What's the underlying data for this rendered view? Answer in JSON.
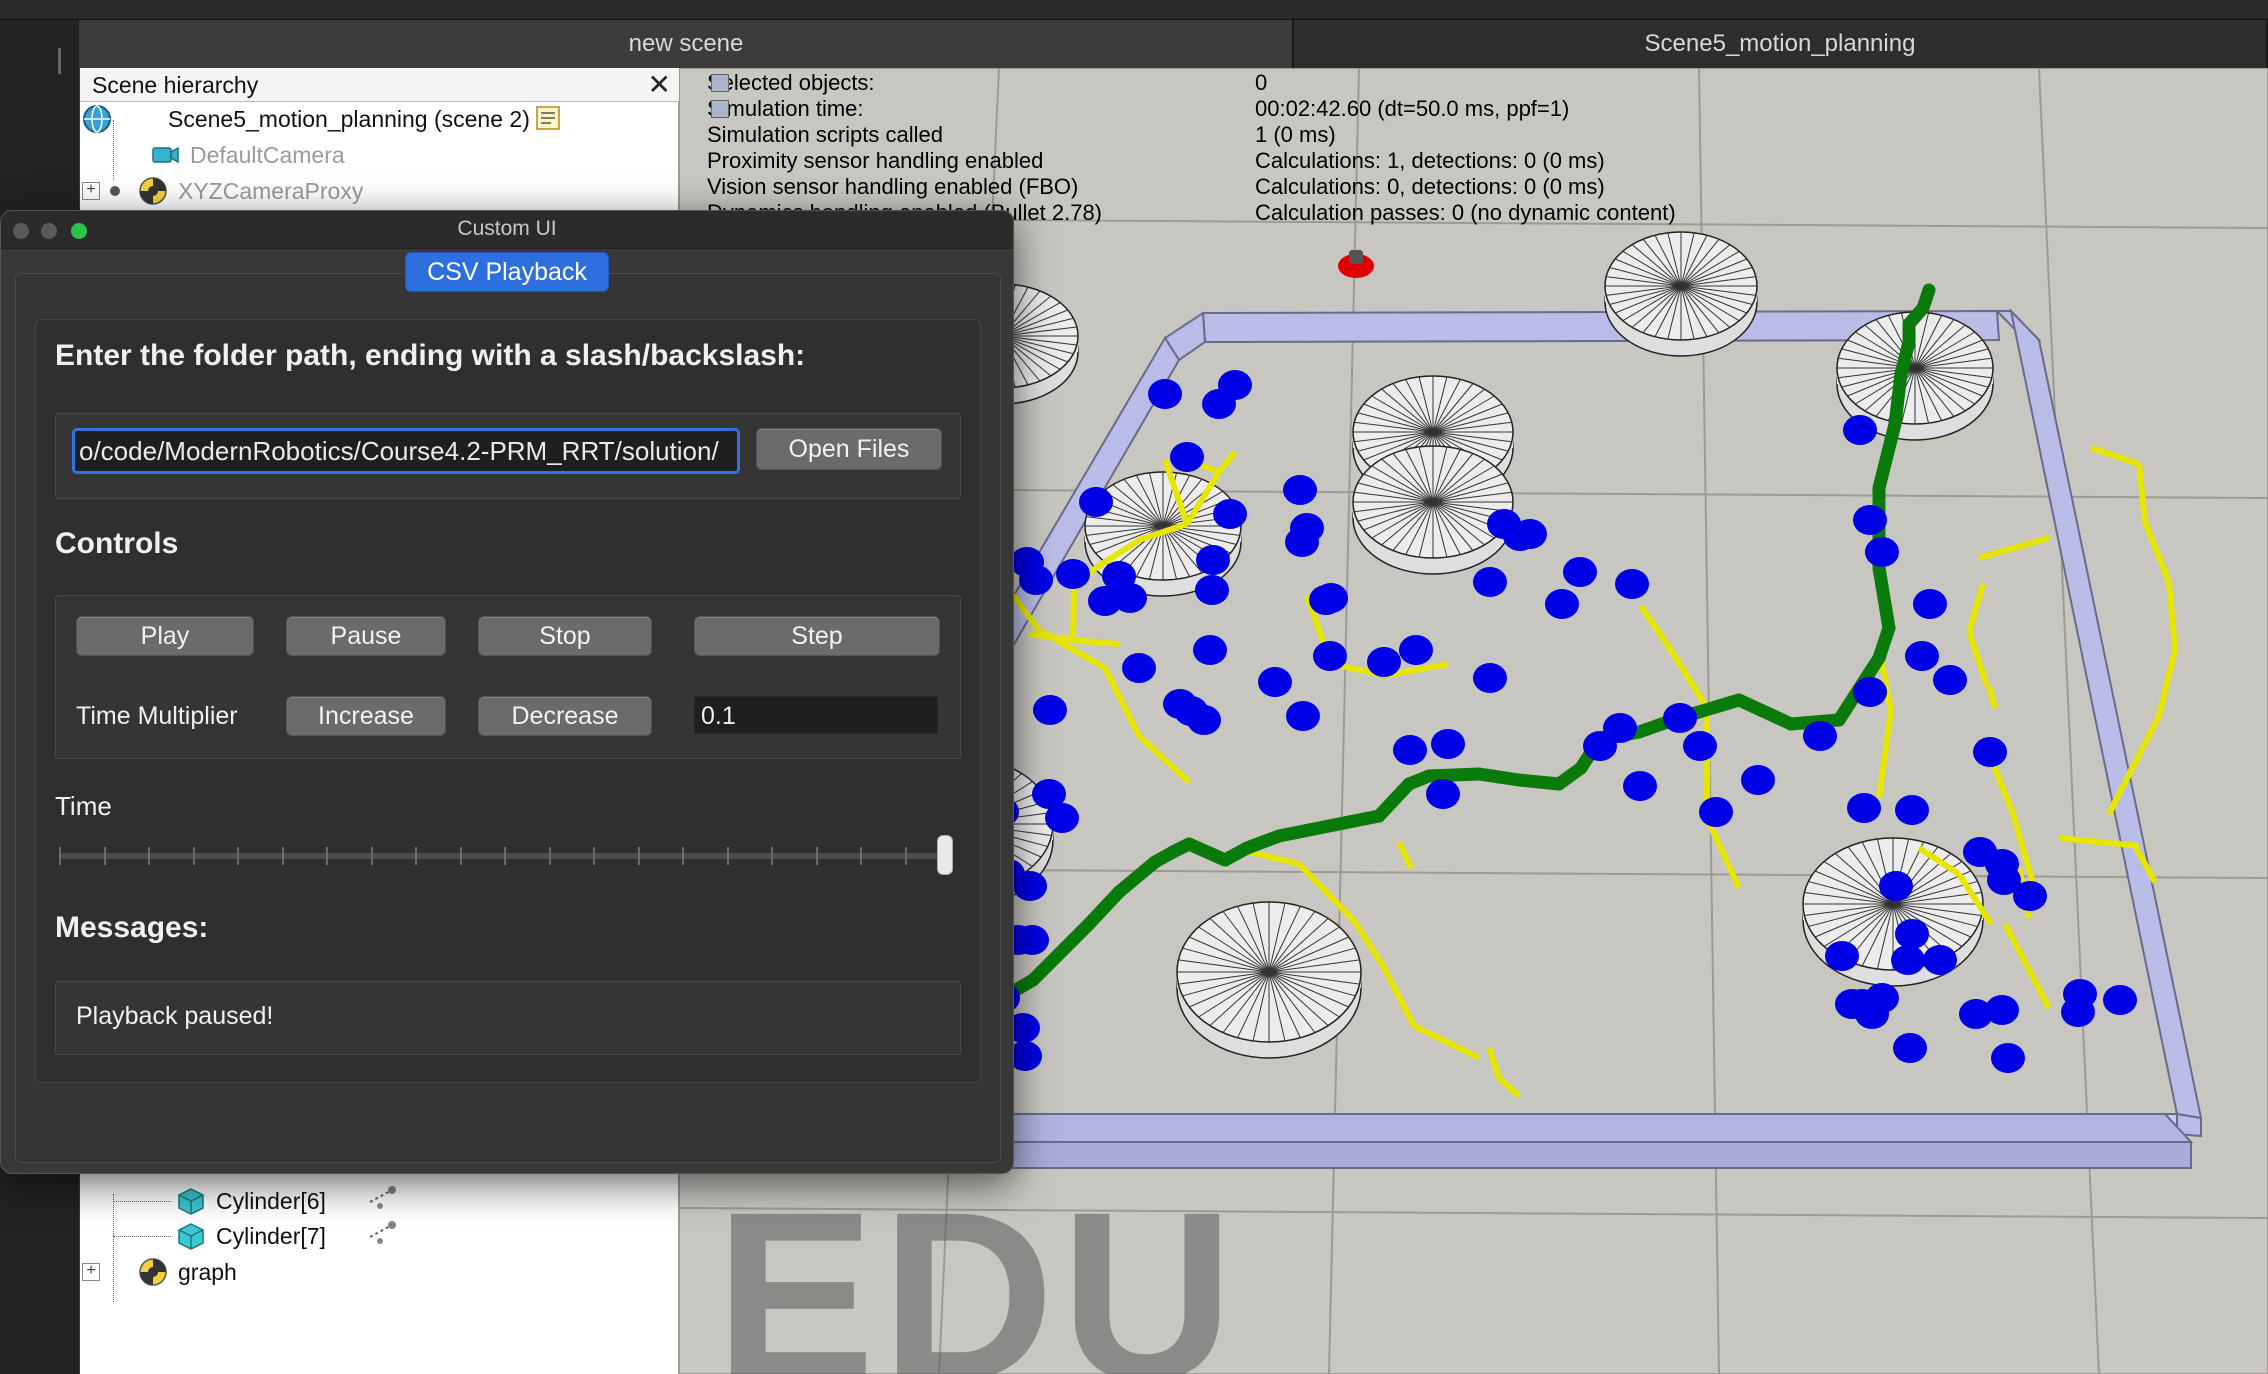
{
  "tabs": [
    {
      "label": "new scene"
    },
    {
      "label": "Scene5_motion_planning"
    }
  ],
  "hierarchy": {
    "title": "Scene hierarchy",
    "close_glyph": "✕",
    "items": [
      {
        "label": "Scene5_motion_planning (scene 2)",
        "icon": "globe-icon"
      },
      {
        "label": "DefaultCamera",
        "icon": "camera-icon"
      },
      {
        "label": "XYZCameraProxy",
        "icon": "dummy-icon"
      },
      {
        "label": "Cylinder[6]",
        "icon": "cube-icon"
      },
      {
        "label": "Cylinder[7]",
        "icon": "cube-icon"
      },
      {
        "label": "graph",
        "icon": "dummy-icon"
      }
    ],
    "expander_glyph": "+"
  },
  "sim_info": [
    {
      "label": "Selected objects:",
      "value": "0"
    },
    {
      "label": "Simulation time:",
      "value": "00:02:42.60 (dt=50.0 ms, ppf=1)"
    },
    {
      "label": "Simulation scripts called",
      "value": "1 (0 ms)"
    },
    {
      "label": "Proximity sensor handling enabled",
      "value": "Calculations: 1, detections: 0 (0 ms)"
    },
    {
      "label": "Vision sensor handling enabled (FBO)",
      "value": "Calculations: 0, detections: 0 (0 ms)"
    },
    {
      "label": "Dynamics handling enabled (Bullet 2.78)",
      "value": "Calculation passes: 0 (no dynamic content)"
    }
  ],
  "watermark": "EDU",
  "custom_ui": {
    "window_title": "Custom UI",
    "tab_label": "CSV Playback",
    "folder_heading": "Enter the folder path, ending with a slash/backslash:",
    "folder_value": "o/code/ModernRobotics/Course4.2-PRM_RRT/solution/",
    "open_files_label": "Open Files",
    "controls_heading": "Controls",
    "buttons": {
      "play": "Play",
      "pause": "Pause",
      "stop": "Stop",
      "step": "Step",
      "increase": "Increase",
      "decrease": "Decrease"
    },
    "time_multiplier_label": "Time Multiplier",
    "time_multiplier_value": "0.1",
    "time_label": "Time",
    "time_slider_position": 1.0,
    "messages_heading": "Messages:",
    "message": "Playback paused!"
  },
  "colors": {
    "accent": "#2d6fde",
    "node": "#0000e6",
    "edge_yellow": "#e6e600",
    "path_green": "#0a7a0a",
    "goal_red": "#e00000",
    "wall": "#b8bce6"
  }
}
